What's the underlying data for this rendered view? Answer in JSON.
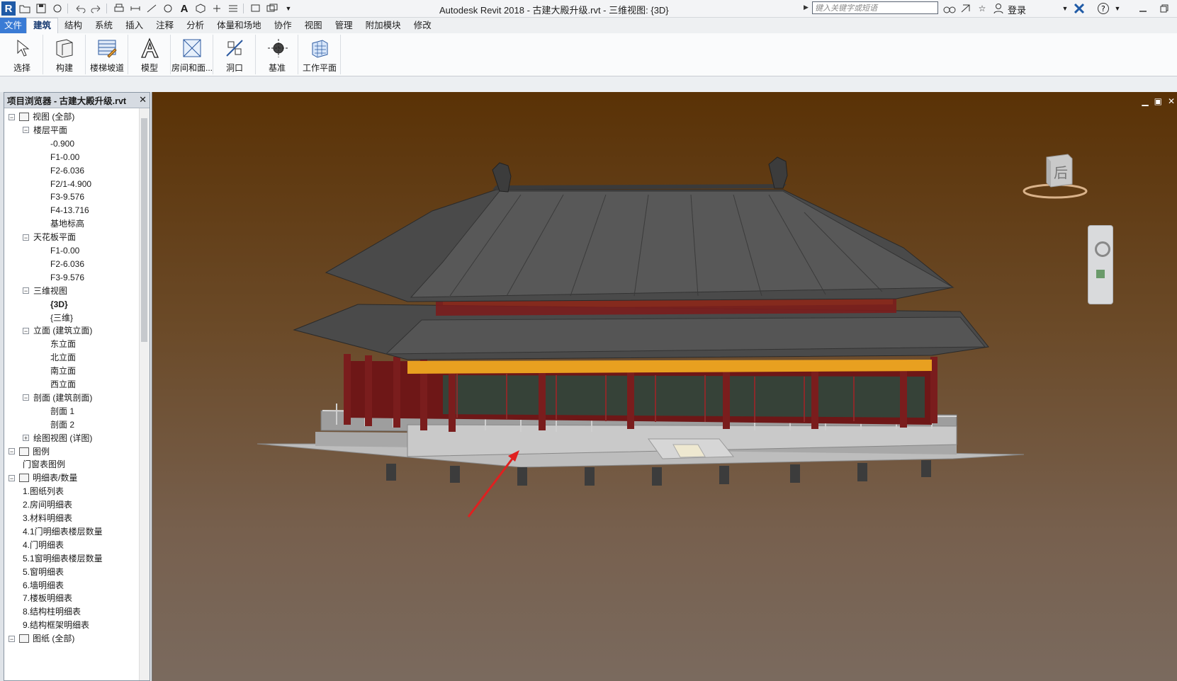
{
  "app": {
    "title": "Autodesk Revit 2018 -    古建大殿升级.rvt - 三维视图: {3D}",
    "search_placeholder": "键入关键字或短语",
    "login_label": "登录"
  },
  "tabs": [
    "文件",
    "建筑",
    "结构",
    "系统",
    "插入",
    "注释",
    "分析",
    "体量和场地",
    "协作",
    "视图",
    "管理",
    "附加模块",
    "修改"
  ],
  "active_tab": "建筑",
  "ribbon": {
    "select": "选择",
    "build": "构建",
    "stairs": "楼梯坡道",
    "model": "模型",
    "room": "房间和面...",
    "opening": "洞口",
    "datum": "基准",
    "workplane": "工作平面"
  },
  "browser": {
    "title": "项目浏览器 - 古建大殿升级.rvt",
    "close": "✕",
    "nodes": [
      {
        "label": "视图 (全部)",
        "level": 0,
        "expand": "−"
      },
      {
        "label": "楼层平面",
        "level": 1,
        "expand": "−"
      },
      {
        "label": "-0.900",
        "level": 2
      },
      {
        "label": "F1-0.00",
        "level": 2
      },
      {
        "label": "F2-6.036",
        "level": 2
      },
      {
        "label": "F2/1-4.900",
        "level": 2
      },
      {
        "label": "F3-9.576",
        "level": 2
      },
      {
        "label": "F4-13.716",
        "level": 2
      },
      {
        "label": "基地标高",
        "level": 2
      },
      {
        "label": "天花板平面",
        "level": 1,
        "expand": "−"
      },
      {
        "label": "F1-0.00",
        "level": 2
      },
      {
        "label": "F2-6.036",
        "level": 2
      },
      {
        "label": "F3-9.576",
        "level": 2
      },
      {
        "label": "三维视图",
        "level": 1,
        "expand": "−"
      },
      {
        "label": "{3D}",
        "level": 2,
        "bold": true
      },
      {
        "label": "{三维}",
        "level": 2
      },
      {
        "label": "立面 (建筑立面)",
        "level": 1,
        "expand": "−"
      },
      {
        "label": "东立面",
        "level": 2
      },
      {
        "label": "北立面",
        "level": 2
      },
      {
        "label": "南立面",
        "level": 2
      },
      {
        "label": "西立面",
        "level": 2
      },
      {
        "label": "剖面 (建筑剖面)",
        "level": 1,
        "expand": "−"
      },
      {
        "label": "剖面 1",
        "level": 2
      },
      {
        "label": "剖面 2",
        "level": 2
      },
      {
        "label": "绘图视图 (详图)",
        "level": 1,
        "expand": "+"
      },
      {
        "label": "图例",
        "level": 0,
        "expand": "−"
      },
      {
        "label": "门窗表图例",
        "level": 1
      },
      {
        "label": "明细表/数量",
        "level": 0,
        "expand": "−"
      },
      {
        "label": "1.图纸列表",
        "level": 1
      },
      {
        "label": "2.房间明细表",
        "level": 1
      },
      {
        "label": "3.材料明细表",
        "level": 1
      },
      {
        "label": "4.1门明细表楼层数量",
        "level": 1
      },
      {
        "label": "4.门明细表",
        "level": 1
      },
      {
        "label": "5.1窗明细表楼层数量",
        "level": 1
      },
      {
        "label": "5.窗明细表",
        "level": 1
      },
      {
        "label": "6.墙明细表",
        "level": 1
      },
      {
        "label": "7.楼板明细表",
        "level": 1
      },
      {
        "label": "8.结构柱明细表",
        "level": 1
      },
      {
        "label": "9.结构框架明细表",
        "level": 1
      },
      {
        "label": "图纸 (全部)",
        "level": 0,
        "expand": "−"
      }
    ]
  },
  "viewcube": {
    "face_label": "后"
  },
  "colors": {
    "accent": "#1f5aa6",
    "arrow": "#e02020",
    "roof": "#4a4a4a",
    "column": "#7a1d1d",
    "beam": "#e8a020"
  }
}
